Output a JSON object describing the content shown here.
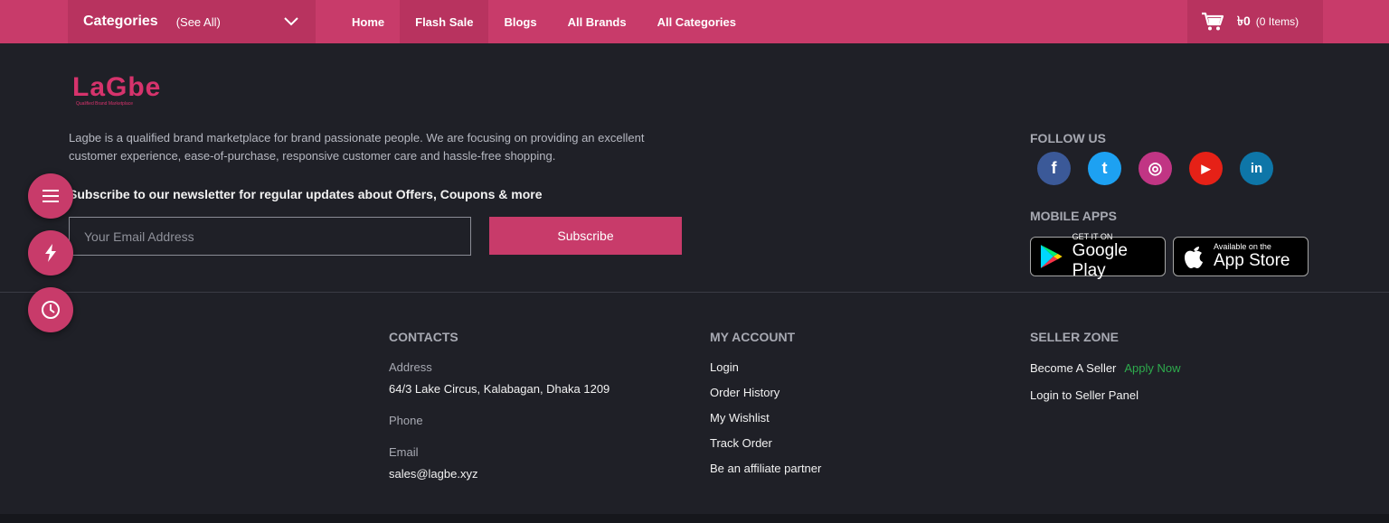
{
  "nav": {
    "categories_label": "Categories",
    "see_all_label": "(See All)",
    "links": [
      "Home",
      "Flash Sale",
      "Blogs",
      "All Brands",
      "All Categories"
    ],
    "active_link": "Flash Sale",
    "cart_amount": "৳0",
    "cart_items": "(0 Items)"
  },
  "brand": {
    "logo_text": "LaGbe",
    "tagline": "Qualified Brand Marketplace",
    "about": "Lagbe is a qualified brand marketplace for brand passionate people. We are focusing on providing an excellent customer experience, ease-of-purchase, responsive customer care and hassle-free shopping."
  },
  "newsletter": {
    "title": "Subscribe to our newsletter for regular updates about Offers, Coupons & more",
    "placeholder": "Your Email Address",
    "button": "Subscribe"
  },
  "follow": {
    "title": "FOLLOW US",
    "socials": [
      {
        "icon": "facebook-icon",
        "glyph": "f",
        "color": "#3b5998"
      },
      {
        "icon": "twitter-icon",
        "glyph": "t",
        "color": "#1da1f2"
      },
      {
        "icon": "instagram-icon",
        "glyph": "◎",
        "color": "#c13584"
      },
      {
        "icon": "youtube-icon",
        "glyph": "▶",
        "color": "#e62117"
      },
      {
        "icon": "linkedin-icon",
        "glyph": "in",
        "color": "#0e76a8"
      }
    ]
  },
  "apps": {
    "title": "MOBILE APPS",
    "google_small": "GET IT ON",
    "google_big": "Google Play",
    "apple_small": "Available on the",
    "apple_big": "App Store"
  },
  "contacts": {
    "title": "CONTACTS",
    "address_label": "Address",
    "address": "64/3 Lake Circus, Kalabagan, Dhaka 1209",
    "phone_label": "Phone",
    "email_label": "Email",
    "email": "sales@lagbe.xyz"
  },
  "account": {
    "title": "MY ACCOUNT",
    "links": [
      "Login",
      "Order History",
      "My Wishlist",
      "Track Order",
      "Be an affiliate partner"
    ]
  },
  "seller": {
    "title": "SELLER ZONE",
    "become": "Become A Seller",
    "apply": "Apply Now",
    "login": "Login to Seller Panel"
  },
  "colors": {
    "primary": "#c83b6a",
    "background": "#1f2027",
    "accent_green": "#2eab4d"
  },
  "floating": [
    "menu-icon",
    "flash-icon",
    "history-icon"
  ]
}
